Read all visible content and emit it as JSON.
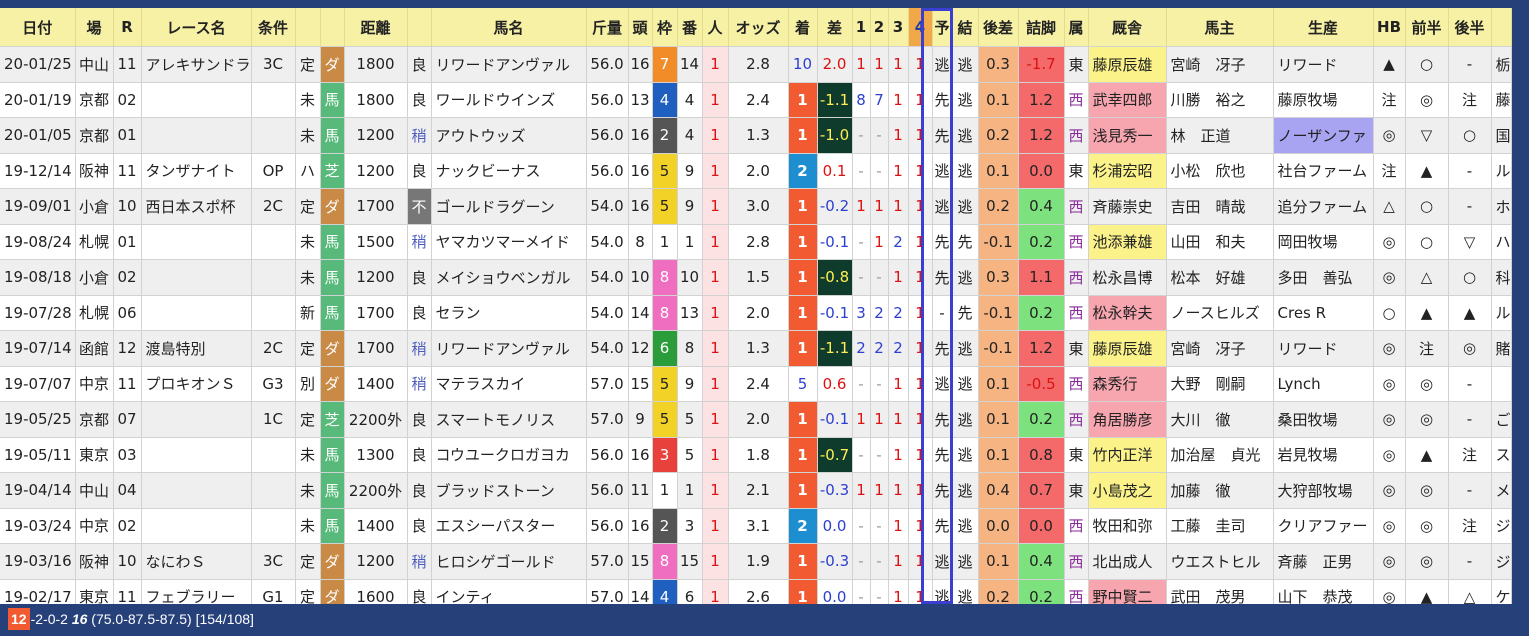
{
  "headers": [
    "日付",
    "場",
    "R",
    "レース名",
    "条件",
    "",
    "",
    "距離",
    "",
    "馬名",
    "斤量",
    "頭",
    "枠",
    "番",
    "人",
    "オッズ",
    "着",
    "差",
    "1",
    "2",
    "3",
    "4",
    "予",
    "結",
    "後差",
    "詰脚",
    "属",
    "厩舎",
    "馬主",
    "生産",
    "HB",
    "前半",
    "後半",
    ""
  ],
  "rows": [
    [
      "20-01/25",
      "中山",
      "11",
      "アレキサンドラ",
      "3C",
      "定",
      "ダ",
      "1800",
      "良",
      "リワードアンヴァル",
      "56.0",
      "16",
      "7",
      "14",
      "1",
      "2.8",
      "10",
      "2.0",
      "1",
      "1",
      "1",
      "1",
      "逃",
      "逃",
      "0.3",
      "-1.7",
      "東",
      "藤原辰雄",
      "宮崎　冴子",
      "リワード",
      "▲",
      "○",
      "-",
      "栃"
    ],
    [
      "20-01/19",
      "京都",
      "02",
      "",
      "",
      "未",
      "馬",
      "1800",
      "良",
      "ワールドウインズ",
      "56.0",
      "13",
      "4",
      "4",
      "1",
      "2.4",
      "1",
      "-1.1",
      "8",
      "7",
      "1",
      "1",
      "先",
      "逃",
      "0.1",
      "1.2",
      "西",
      "武幸四郎",
      "川勝　裕之",
      "藤原牧場",
      "注",
      "◎",
      "注",
      "藤"
    ],
    [
      "20-01/05",
      "京都",
      "01",
      "",
      "",
      "未",
      "馬",
      "1200",
      "稍",
      "アウトウッズ",
      "56.0",
      "16",
      "2",
      "4",
      "1",
      "1.3",
      "1",
      "-1.0",
      "-",
      "-",
      "1",
      "1",
      "先",
      "逃",
      "0.2",
      "1.2",
      "西",
      "浅見秀一",
      "林　正道",
      "ノーザンファ",
      "◎",
      "▽",
      "○",
      "国"
    ],
    [
      "19-12/14",
      "阪神",
      "11",
      "タンザナイト",
      "OP",
      "ハ",
      "芝",
      "1200",
      "良",
      "ナックビーナス",
      "56.0",
      "16",
      "5",
      "9",
      "1",
      "2.0",
      "2",
      "0.1",
      "-",
      "-",
      "1",
      "1",
      "逃",
      "逃",
      "0.1",
      "0.0",
      "東",
      "杉浦宏昭",
      "小松　欣也",
      "社台ファーム",
      "注",
      "▲",
      "-",
      "ル"
    ],
    [
      "19-09/01",
      "小倉",
      "10",
      "西日本スポ杯",
      "2C",
      "定",
      "ダ",
      "1700",
      "不",
      "ゴールドラグーン",
      "54.0",
      "16",
      "5",
      "9",
      "1",
      "3.0",
      "1",
      "-0.2",
      "1",
      "1",
      "1",
      "1",
      "逃",
      "逃",
      "0.2",
      "0.4",
      "西",
      "斉藤崇史",
      "吉田　晴哉",
      "追分ファーム",
      "△",
      "○",
      "-",
      "ホ"
    ],
    [
      "19-08/24",
      "札幌",
      "01",
      "",
      "",
      "未",
      "馬",
      "1500",
      "稍",
      "ヤマカツマーメイド",
      "54.0",
      "8",
      "1",
      "1",
      "1",
      "2.8",
      "1",
      "-0.1",
      "-",
      "1",
      "2",
      "1",
      "先",
      "先",
      "-0.1",
      "0.2",
      "西",
      "池添兼雄",
      "山田　和夫",
      "岡田牧場",
      "◎",
      "○",
      "▽",
      "ハ"
    ],
    [
      "19-08/18",
      "小倉",
      "02",
      "",
      "",
      "未",
      "馬",
      "1200",
      "良",
      "メイショウベンガル",
      "54.0",
      "10",
      "8",
      "10",
      "1",
      "1.5",
      "1",
      "-0.8",
      "-",
      "-",
      "1",
      "1",
      "先",
      "逃",
      "0.3",
      "1.1",
      "西",
      "松永昌博",
      "松本　好雄",
      "多田　善弘",
      "◎",
      "△",
      "○",
      "科"
    ],
    [
      "19-07/28",
      "札幌",
      "06",
      "",
      "",
      "新",
      "馬",
      "1700",
      "良",
      "セラン",
      "54.0",
      "14",
      "8",
      "13",
      "1",
      "2.0",
      "1",
      "-0.1",
      "3",
      "2",
      "2",
      "1",
      "-",
      "先",
      "-0.1",
      "0.2",
      "西",
      "松永幹夫",
      "ノースヒルズ",
      "Cres R",
      "○",
      "▲",
      "▲",
      "ル"
    ],
    [
      "19-07/14",
      "函館",
      "12",
      "渡島特別",
      "2C",
      "定",
      "ダ",
      "1700",
      "稍",
      "リワードアンヴァル",
      "54.0",
      "12",
      "6",
      "8",
      "1",
      "1.3",
      "1",
      "-1.1",
      "2",
      "2",
      "2",
      "1",
      "先",
      "逃",
      "-0.1",
      "1.2",
      "東",
      "藤原辰雄",
      "宮崎　冴子",
      "リワード",
      "◎",
      "注",
      "◎",
      "賭"
    ],
    [
      "19-07/07",
      "中京",
      "11",
      "プロキオンＳ",
      "G3",
      "別",
      "ダ",
      "1400",
      "稍",
      "マテラスカイ",
      "57.0",
      "15",
      "5",
      "9",
      "1",
      "2.4",
      "5",
      "0.6",
      "-",
      "-",
      "1",
      "1",
      "逃",
      "逃",
      "0.1",
      "-0.5",
      "西",
      "森秀行",
      "大野　剛嗣",
      "Lynch",
      "◎",
      "◎",
      "-",
      ""
    ],
    [
      "19-05/25",
      "京都",
      "07",
      "",
      "1C",
      "定",
      "芝",
      "2200外",
      "良",
      "スマートモノリス",
      "57.0",
      "9",
      "5",
      "5",
      "1",
      "2.0",
      "1",
      "-0.1",
      "1",
      "1",
      "1",
      "1",
      "先",
      "逃",
      "0.1",
      "0.2",
      "西",
      "角居勝彦",
      "大川　徹",
      "桑田牧場",
      "◎",
      "◎",
      "-",
      "ご"
    ],
    [
      "19-05/11",
      "東京",
      "03",
      "",
      "",
      "未",
      "馬",
      "1300",
      "良",
      "コウユークロガヨカ",
      "56.0",
      "16",
      "3",
      "5",
      "1",
      "1.8",
      "1",
      "-0.7",
      "-",
      "-",
      "1",
      "1",
      "先",
      "逃",
      "0.1",
      "0.8",
      "東",
      "竹内正洋",
      "加治屋　貞光",
      "岩見牧場",
      "◎",
      "▲",
      "注",
      "ス"
    ],
    [
      "19-04/14",
      "中山",
      "04",
      "",
      "",
      "未",
      "馬",
      "2200外",
      "良",
      "ブラッドストーン",
      "56.0",
      "11",
      "1",
      "1",
      "1",
      "2.1",
      "1",
      "-0.3",
      "1",
      "1",
      "1",
      "1",
      "先",
      "逃",
      "0.4",
      "0.7",
      "東",
      "小島茂之",
      "加藤　徹",
      "大狩部牧場",
      "◎",
      "◎",
      "-",
      "メ"
    ],
    [
      "19-03/24",
      "中京",
      "02",
      "",
      "",
      "未",
      "馬",
      "1400",
      "良",
      "エスシーパスター",
      "56.0",
      "16",
      "2",
      "3",
      "1",
      "3.1",
      "2",
      "0.0",
      "-",
      "-",
      "1",
      "1",
      "先",
      "逃",
      "0.0",
      "0.0",
      "西",
      "牧田和弥",
      "工藤　圭司",
      "クリアファー",
      "◎",
      "◎",
      "注",
      "ジ"
    ],
    [
      "19-03/16",
      "阪神",
      "10",
      "なにわＳ",
      "3C",
      "定",
      "ダ",
      "1200",
      "稍",
      "ヒロシゲゴールド",
      "57.0",
      "15",
      "8",
      "15",
      "1",
      "1.9",
      "1",
      "-0.3",
      "-",
      "-",
      "1",
      "1",
      "逃",
      "逃",
      "0.1",
      "0.4",
      "西",
      "北出成人",
      "ウエストヒル",
      "斉藤　正男",
      "◎",
      "◎",
      "-",
      "ジ"
    ],
    [
      "19-02/17",
      "東京",
      "11",
      "フェブラリー",
      "G1",
      "定",
      "ダ",
      "1600",
      "良",
      "インティ",
      "57.0",
      "14",
      "4",
      "6",
      "1",
      "2.6",
      "1",
      "0.0",
      "-",
      "-",
      "1",
      "1",
      "逃",
      "逃",
      "0.2",
      "0.2",
      "西",
      "野中賢二",
      "武田　茂男",
      "山下　恭茂",
      "◎",
      "▲",
      "△",
      "ケ"
    ]
  ],
  "footer": {
    "wins": "12",
    "rest": "-2-0-2 ",
    "count": "16",
    "stats": " (75.0-87.5-87.5) [154/108]"
  },
  "colors": {
    "accent": "#26407a",
    "header": "#f7f1a6",
    "frame": "#3b3fcf"
  }
}
